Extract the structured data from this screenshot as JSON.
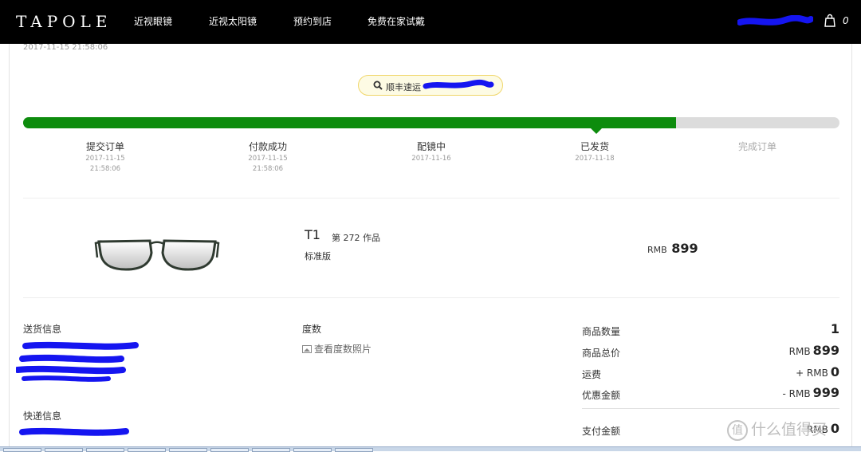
{
  "header": {
    "logo": "TAPOLE",
    "nav": [
      "近视眼镜",
      "近视太阳镜",
      "预约到店",
      "免费在家试戴"
    ],
    "cart_count": "0"
  },
  "order": {
    "time": "2017-11-15 21:58:06",
    "carrier": "顺丰速运"
  },
  "progress": {
    "fraction": 0.8,
    "steps": [
      {
        "label": "提交订单",
        "date": "2017-11-15",
        "time": "21:58:06"
      },
      {
        "label": "付款成功",
        "date": "2017-11-15",
        "time": "21:58:06"
      },
      {
        "label": "配镜中",
        "date": "2017-11-16",
        "time": ""
      },
      {
        "label": "已发货",
        "date": "2017-11-18",
        "time": ""
      },
      {
        "label": "完成订单",
        "date": "",
        "time": ""
      }
    ]
  },
  "product": {
    "name": "T1",
    "edition": "第 272 作品",
    "variant": "标准版",
    "currency": "RMB",
    "price": "899"
  },
  "shipping": {
    "title": "送货信息",
    "express_title": "快递信息"
  },
  "prescription": {
    "title": "度数",
    "photo_link": "查看度数照片"
  },
  "summary": {
    "quantity_label": "商品数量",
    "quantity": "1",
    "total_label": "商品总价",
    "total_prefix": "RMB",
    "total": "899",
    "shipping_label": "运费",
    "shipping_prefix": "+ RMB",
    "shipping": "0",
    "discount_label": "优惠金额",
    "discount_prefix": "- RMB",
    "discount": "999",
    "pay_label": "支付金额",
    "pay_prefix": "RMB",
    "pay": "0"
  },
  "watermark": {
    "icon": "值",
    "text": "什么值得买"
  },
  "colors": {
    "progress_done": "#0d8c0d",
    "progress_todo": "#dcdcdc",
    "tracking_border": "#f0d66a",
    "redaction": "#1515f0"
  }
}
